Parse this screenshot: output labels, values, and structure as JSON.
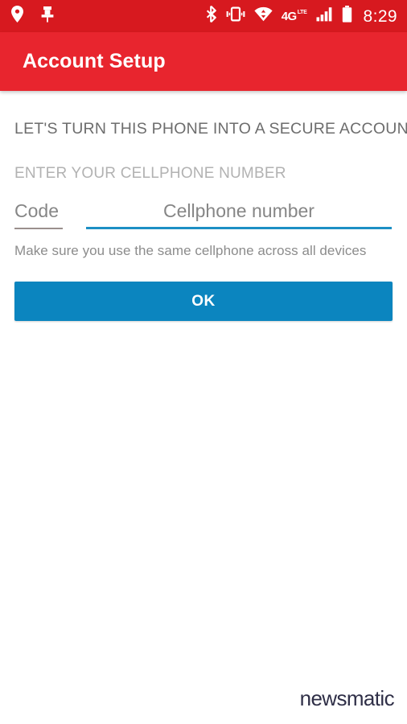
{
  "status_bar": {
    "icons_left": [
      {
        "name": "location-pin-icon",
        "label": "Location"
      },
      {
        "name": "pushpin-icon",
        "label": "Pinned"
      }
    ],
    "icons_right": [
      {
        "name": "bluetooth-icon",
        "label": "Bluetooth"
      },
      {
        "name": "vibrate-icon",
        "label": "Vibrate mode"
      },
      {
        "name": "wifi-icon",
        "label": "Wi-Fi"
      },
      {
        "name": "network-4glte-icon",
        "label": "4G LTE"
      },
      {
        "name": "signal-bars-icon",
        "label": "Cellular signal"
      },
      {
        "name": "battery-icon",
        "label": "Battery"
      }
    ],
    "network_4g": "4G",
    "network_lte": "LTE",
    "time": "8:29",
    "background_color": "#d7191f"
  },
  "app_bar": {
    "title": "Account Setup",
    "background_color": "#e8252e",
    "text_color": "#ffffff"
  },
  "main": {
    "headline": "LET'S TURN THIS PHONE INTO A SECURE ACCOUNT",
    "subheading": "ENTER YOUR CELLPHONE NUMBER",
    "code_field": {
      "value": "",
      "placeholder": "Code",
      "underline_color": "#9a8f8d",
      "focused": false
    },
    "phone_field": {
      "value": "",
      "placeholder": "Cellphone number",
      "underline_color": "#1d8fc4",
      "focused": true
    },
    "helper_text": "Make sure you use the same cellphone across all devices",
    "ok_button": {
      "label": "OK",
      "background_color": "#0b85bf",
      "text_color": "#ffffff"
    }
  },
  "watermark": {
    "text": "newsmatic",
    "color": "#2f2f47"
  }
}
